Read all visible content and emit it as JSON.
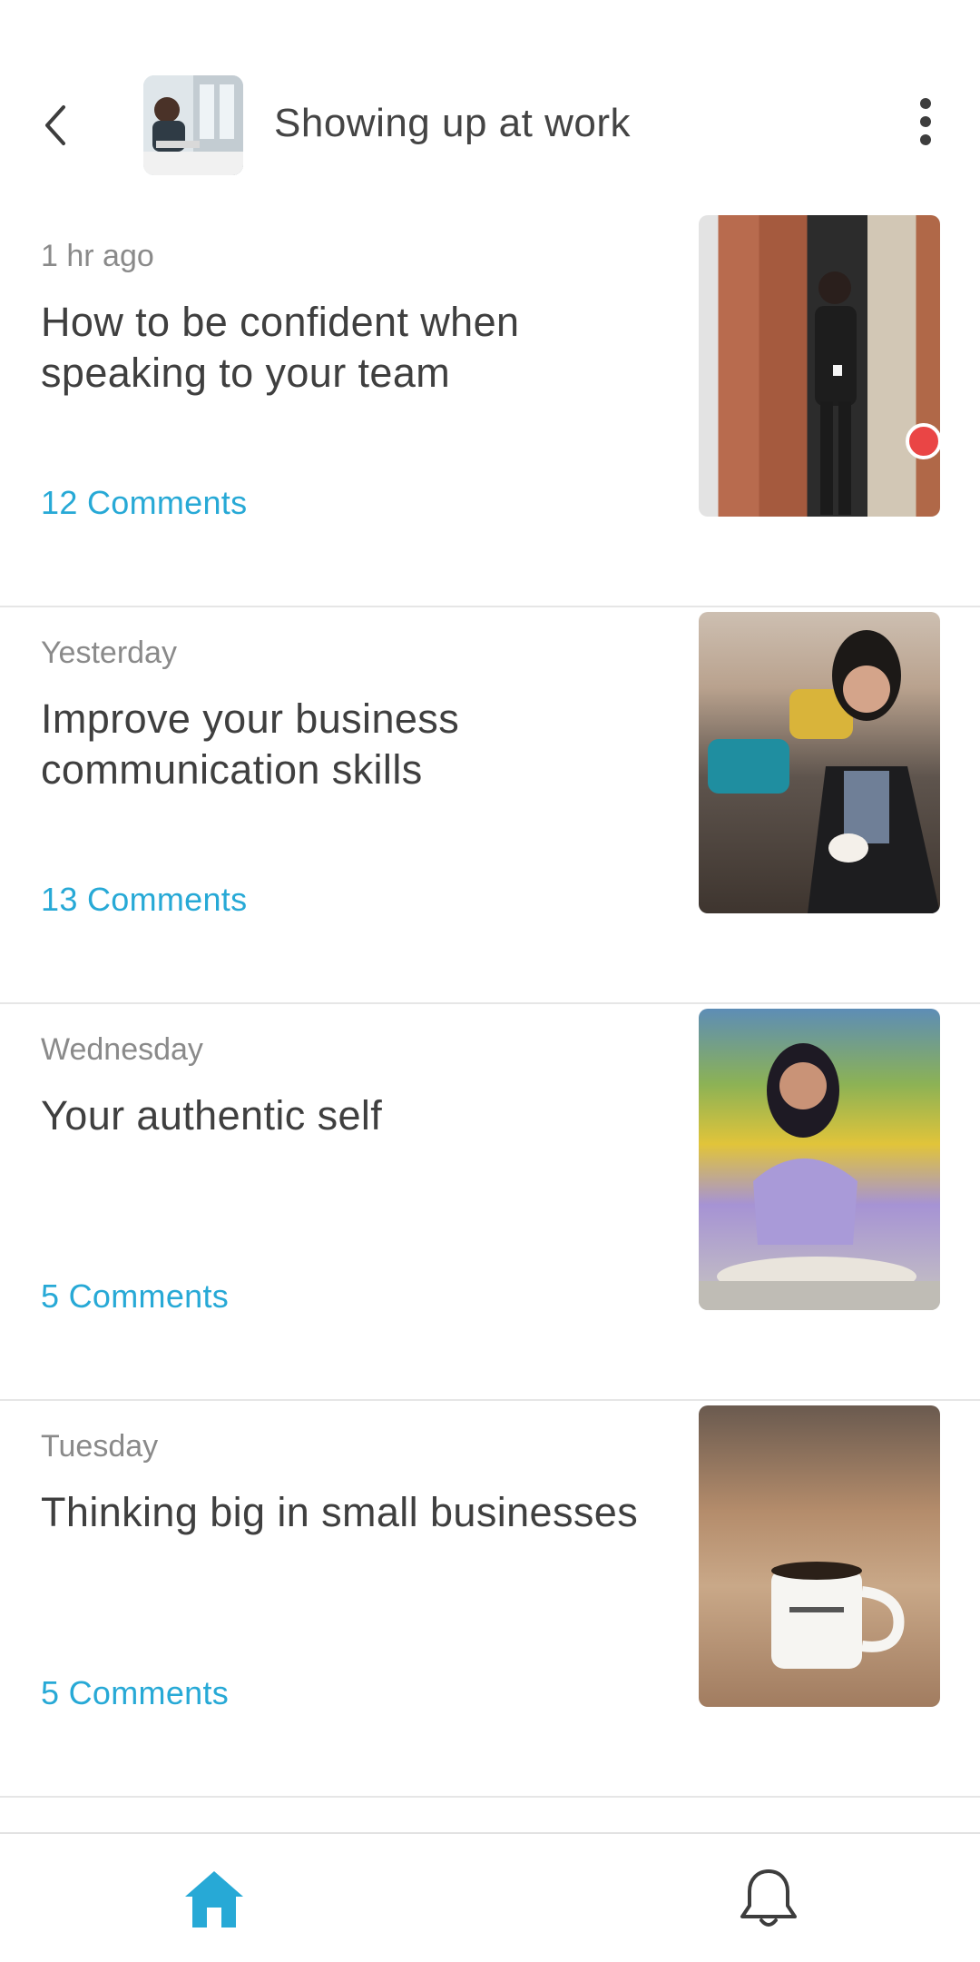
{
  "header": {
    "title": "Showing up at work",
    "back_icon": "chevron-left-icon",
    "more_icon": "more-vertical-icon"
  },
  "posts": [
    {
      "time": "1 hr ago",
      "title": "How to be confident when speaking to your team",
      "comments": "12 Comments",
      "unread": true
    },
    {
      "time": "Yesterday",
      "title": "Improve your business communication skills",
      "comments": "13 Comments",
      "unread": false
    },
    {
      "time": "Wednesday",
      "title": "Your authentic self",
      "comments": "5 Comments",
      "unread": false
    },
    {
      "time": "Tuesday",
      "title": "Thinking big in small businesses",
      "comments": "5 Comments",
      "unread": false
    }
  ],
  "bottom_nav": {
    "home_icon": "home-icon",
    "bell_icon": "bell-icon",
    "active": "home"
  },
  "colors": {
    "accent": "#27a9d6",
    "unread_dot": "#ea4545",
    "title_text": "#3f3f3f",
    "meta_text": "#8a8a8a"
  }
}
